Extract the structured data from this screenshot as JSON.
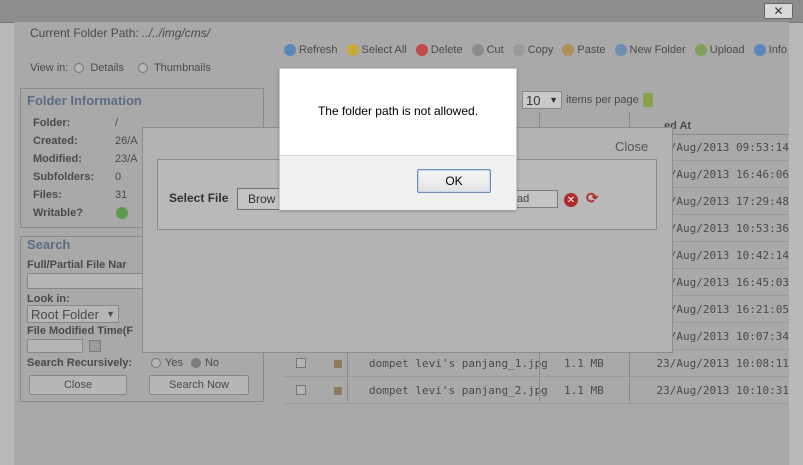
{
  "folder_path": {
    "label": "Current Folder Path:",
    "value": "../../img/cms/"
  },
  "toolbar": {
    "items": [
      {
        "label": "Refresh",
        "icon": "refresh-icon",
        "color": "#5a86b8"
      },
      {
        "label": "Select All",
        "icon": "select-all-icon",
        "color": "#c9a93c"
      },
      {
        "label": "Delete",
        "icon": "delete-icon",
        "color": "#c24b4b"
      },
      {
        "label": "Cut",
        "icon": "cut-icon",
        "color": "#8c8c8c"
      },
      {
        "label": "Copy",
        "icon": "copy-icon",
        "color": "#9a9a9a"
      },
      {
        "label": "Paste",
        "icon": "paste-icon",
        "color": "#b0905a"
      },
      {
        "label": "New Folder",
        "icon": "new-folder-icon",
        "color": "#6d8fb3"
      },
      {
        "label": "Upload",
        "icon": "upload-icon",
        "color": "#7ea05a"
      },
      {
        "label": "Info",
        "icon": "info-icon",
        "color": "#5a86b8"
      }
    ]
  },
  "view": {
    "label": "View in:",
    "details": "Details",
    "thumbnails": "Thumbnails"
  },
  "folder_info": {
    "title": "Folder Information",
    "rows": [
      {
        "label": "Folder:",
        "value": "/"
      },
      {
        "label": "Created:",
        "value": "26/A"
      },
      {
        "label": "Modified:",
        "value": "23/A"
      },
      {
        "label": "Subfolders:",
        "value": "0"
      },
      {
        "label": "Files:",
        "value": "31"
      },
      {
        "label": "Writable?",
        "value": ""
      }
    ]
  },
  "search": {
    "title": "Search",
    "name_label": "Full/Partial File Nar",
    "look_in_label": "Look in:",
    "look_in_value": "Root Folder",
    "modified_label": "File Modified Time(F",
    "recursive_label": "Search Recursively:",
    "yes": "Yes",
    "no": "No",
    "close_btn": "Close",
    "search_btn": "Search Now"
  },
  "pager": {
    "per_page_value": "10",
    "per_page_label": "items per page"
  },
  "grid": {
    "modified_header": "ed At",
    "rows": [
      {
        "name": "",
        "size": "",
        "date": "3/Aug/2013 09:53:14"
      },
      {
        "name": "",
        "size": "",
        "date": "3/Aug/2013 16:46:06"
      },
      {
        "name": "",
        "size": "",
        "date": "3/Aug/2013 17:29:48"
      },
      {
        "name": "",
        "size": "",
        "date": "3/Aug/2013 10:53:36"
      },
      {
        "name": "",
        "size": "",
        "date": "3/Aug/2013 10:42:14"
      },
      {
        "name": "",
        "size": "",
        "date": "3/Aug/2013 16:45:03"
      },
      {
        "name": "",
        "size": "",
        "date": "3/Aug/2013 16:21:05"
      },
      {
        "name": "",
        "size": "",
        "date": "3/Aug/2013 10:07:34"
      },
      {
        "name": "dompet levi's panjang_1.jpg",
        "size": "1.1 MB",
        "date": "23/Aug/2013 10:08:11"
      },
      {
        "name": "dompet levi's panjang_2.jpg",
        "size": "1.1 MB",
        "date": "23/Aug/2013 10:10:31"
      }
    ]
  },
  "upload_dialog": {
    "close": "Close",
    "select_file_label": "Select File",
    "browse_label": "Brow",
    "upload_label": "ad"
  },
  "alert": {
    "message": "The folder path is not allowed.",
    "ok_label": "OK"
  },
  "window": {
    "close_glyph": "✕"
  }
}
